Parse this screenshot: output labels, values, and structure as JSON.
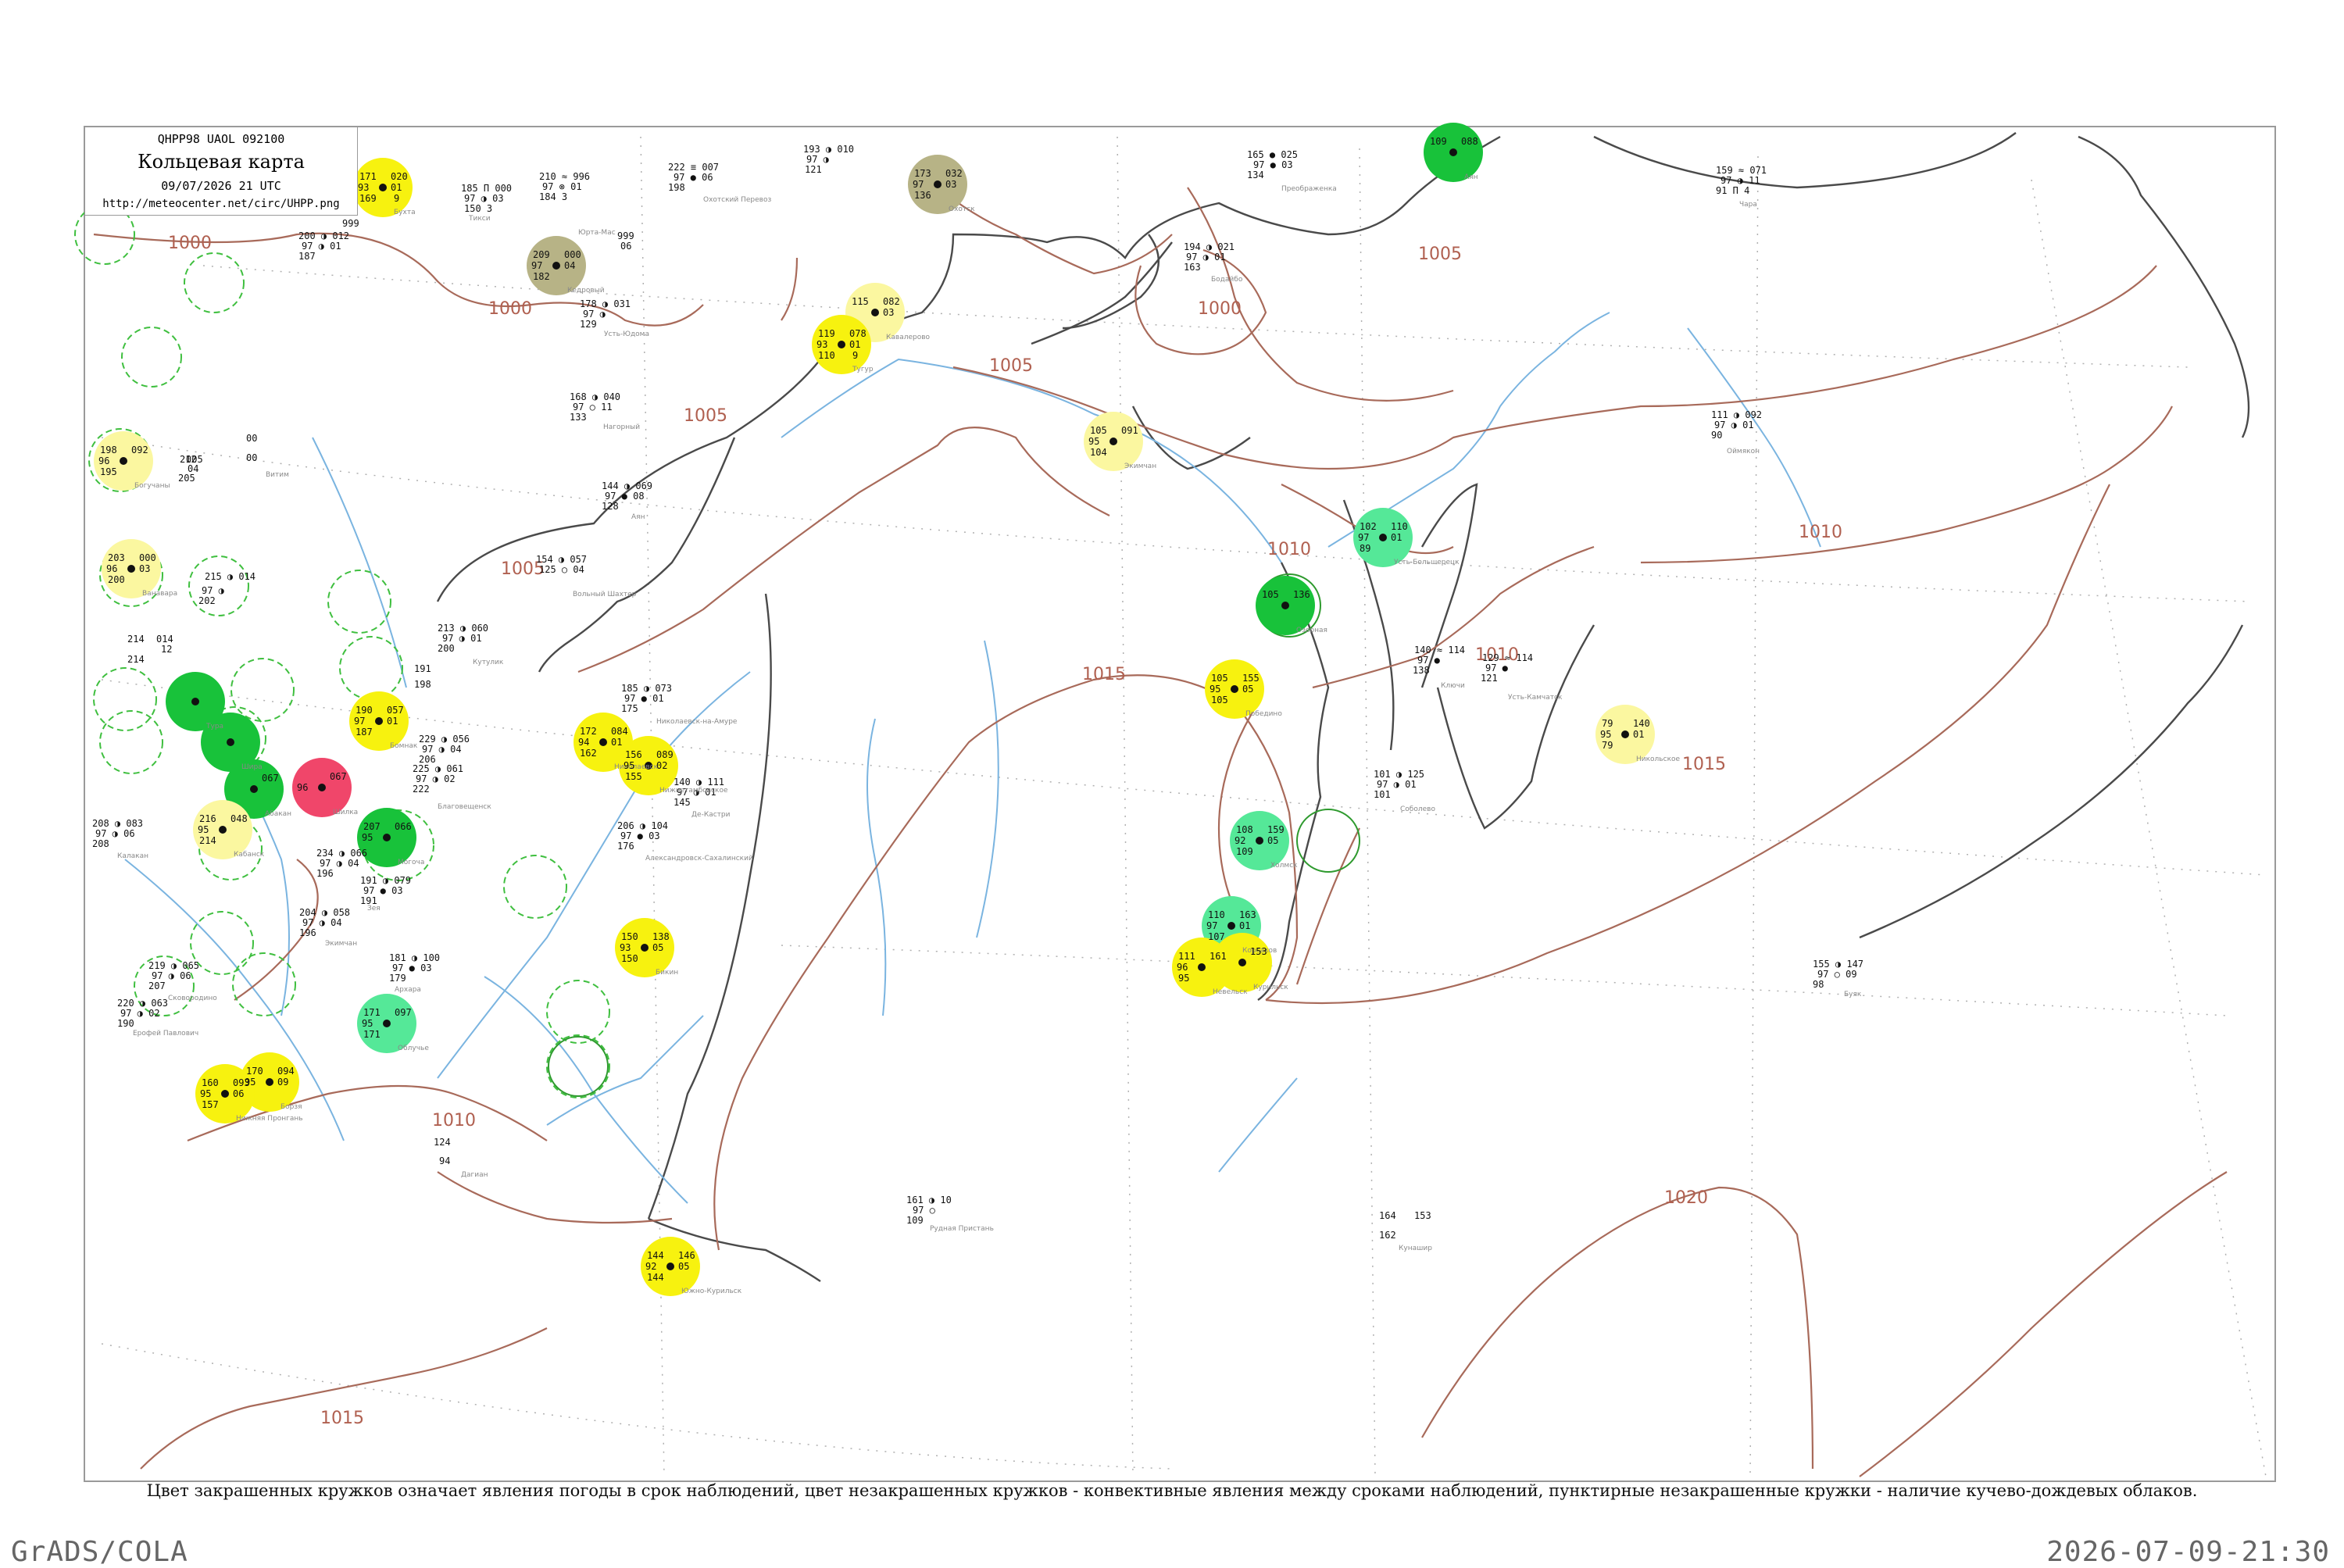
{
  "title_box": {
    "code": "QHPP98  UAOL  092100",
    "title": "Кольцевая карта",
    "date": "09/07/2026 21 UTC",
    "url": "http://meteocenter.net/circ/UHPP.png"
  },
  "caption": "Цвет закрашенных кружков означает явления погоды в срок наблюдений, цвет незакрашенных кружков - конвективные явления между сроками наблюдений, пунктирные незакрашенные кружки - наличие кучево-дождевых облаков.",
  "footer": {
    "left": "GrADS/COLA",
    "right": "2026-07-09-21:30"
  },
  "colors": {
    "isobar": "#a86a5a",
    "coastline": "#4a4a4a",
    "river": "#7ab4e0",
    "yellow": "#f7f20f",
    "light_yellow": "#fbf7a0",
    "green": "#18c23a",
    "light_green": "#55e898",
    "olive": "#b7b386",
    "red": "#f0466a",
    "dashed_green": "#3fbf3f"
  },
  "isobar_labels": [
    {
      "text": "1000"
    },
    {
      "text": "1000"
    },
    {
      "text": "1000"
    },
    {
      "text": "1005"
    },
    {
      "text": "1005"
    },
    {
      "text": "1005"
    },
    {
      "text": "1005"
    },
    {
      "text": "1010"
    },
    {
      "text": "1010"
    },
    {
      "text": "1010"
    },
    {
      "text": "1010"
    },
    {
      "text": "1015"
    },
    {
      "text": "1015"
    },
    {
      "text": "1015"
    },
    {
      "text": "1020"
    }
  ],
  "stations": [
    {
      "fill": "yellow",
      "vals": [
        "171",
        "93",
        "169",
        "020",
        "01",
        "9"
      ],
      "name": "Бухта"
    },
    {
      "fill": "olive",
      "vals": [
        "209",
        "97",
        "182",
        "000",
        "04",
        ""
      ],
      "name": "Кедровый"
    },
    {
      "fill": "olive",
      "vals": [
        "173",
        "97",
        "136",
        "032",
        "03",
        ""
      ],
      "name": "Охотск"
    },
    {
      "fill": "green",
      "vals": [
        "109",
        "",
        "",
        "088",
        "",
        ""
      ],
      "name": "Аян"
    },
    {
      "fill": "light_yellow",
      "vals": [
        "115",
        "",
        "",
        "082",
        "03",
        ""
      ],
      "name": "Кавалерово"
    },
    {
      "fill": "yellow",
      "vals": [
        "119",
        "93",
        "110",
        "078",
        "01",
        "9"
      ],
      "name": "Тугур"
    },
    {
      "fill": "light_yellow",
      "vals": [
        "105",
        "95",
        "104",
        "091",
        "",
        ""
      ],
      "name": "Экимчан"
    },
    {
      "fill": "light_green",
      "vals": [
        "102",
        "97",
        "89",
        "110",
        "01",
        ""
      ],
      "name": "Усть-Большерецк"
    },
    {
      "fill": "green",
      "vals": [
        "105",
        "",
        "",
        "136",
        "",
        ""
      ],
      "name": "Озерная"
    },
    {
      "fill": "yellow",
      "vals": [
        "105",
        "95",
        "105",
        "155",
        "05",
        ""
      ],
      "name": "Победино"
    },
    {
      "fill": "light_yellow",
      "vals": [
        "79",
        "95",
        "79",
        "140",
        "01",
        ""
      ],
      "name": "Никольское"
    },
    {
      "fill": "light_green",
      "vals": [
        "108",
        "92",
        "109",
        "159",
        "05",
        ""
      ],
      "name": "Холмск"
    },
    {
      "fill": "light_green",
      "vals": [
        "110",
        "97",
        "107",
        "163",
        "01",
        ""
      ],
      "name": "Корсаков"
    },
    {
      "fill": "yellow",
      "vals": [
        "111",
        "96",
        "95",
        "161",
        "",
        ""
      ],
      "name": "Невельск"
    },
    {
      "fill": "yellow",
      "vals": [
        "",
        "",
        "",
        "153",
        "",
        ""
      ],
      "name": "Курильск"
    },
    {
      "fill": "light_yellow",
      "vals": [
        "198",
        "96",
        "195",
        "092",
        "",
        ""
      ],
      "name": "Богучаны"
    },
    {
      "fill": "light_yellow",
      "vals": [
        "203",
        "96",
        "200",
        "000",
        "03",
        ""
      ],
      "name": "Ванавара"
    },
    {
      "fill": "green",
      "vals": [
        "",
        "",
        "",
        "",
        "",
        ""
      ],
      "name": "Тура"
    },
    {
      "fill": "green",
      "vals": [
        "",
        "",
        "",
        "",
        "",
        ""
      ],
      "name": "Шира"
    },
    {
      "fill": "green",
      "vals": [
        "",
        "",
        "",
        "067",
        "",
        ""
      ],
      "name": "Абакан"
    },
    {
      "fill": "red",
      "vals": [
        "",
        "96",
        "",
        "067",
        "",
        ""
      ],
      "name": "Шилка"
    },
    {
      "fill": "green",
      "vals": [
        "207",
        "95",
        "",
        "066",
        "",
        ""
      ],
      "name": "Могоча"
    },
    {
      "fill": "light_yellow",
      "vals": [
        "216",
        "95",
        "214",
        "048",
        "",
        ""
      ],
      "name": "Кабанск"
    },
    {
      "fill": "yellow",
      "vals": [
        "190",
        "97",
        "187",
        "057",
        "01",
        ""
      ],
      "name": "Бомнак"
    },
    {
      "fill": "yellow",
      "vals": [
        "172",
        "94",
        "162",
        "084",
        "01",
        ""
      ],
      "name": "Николаевск"
    },
    {
      "fill": "yellow",
      "vals": [
        "156",
        "95",
        "155",
        "089",
        "02",
        ""
      ],
      "name": "Нижнетамбовское"
    },
    {
      "fill": "yellow",
      "vals": [
        "150",
        "93",
        "150",
        "138",
        "05",
        ""
      ],
      "name": "Бикин"
    },
    {
      "fill": "light_green",
      "vals": [
        "171",
        "95",
        "171",
        "097",
        "",
        ""
      ],
      "name": "Облучье"
    },
    {
      "fill": "yellow",
      "vals": [
        "170",
        "95",
        "",
        "094",
        "09",
        ""
      ],
      "name": "Борзя"
    },
    {
      "fill": "yellow",
      "vals": [
        "160",
        "95",
        "157",
        "093",
        "06",
        ""
      ],
      "name": "Нижняя Пронгань"
    },
    {
      "fill": "yellow",
      "vals": [
        "144",
        "92",
        "144",
        "146",
        "05",
        ""
      ],
      "name": "Южно-Курильск"
    }
  ]
}
